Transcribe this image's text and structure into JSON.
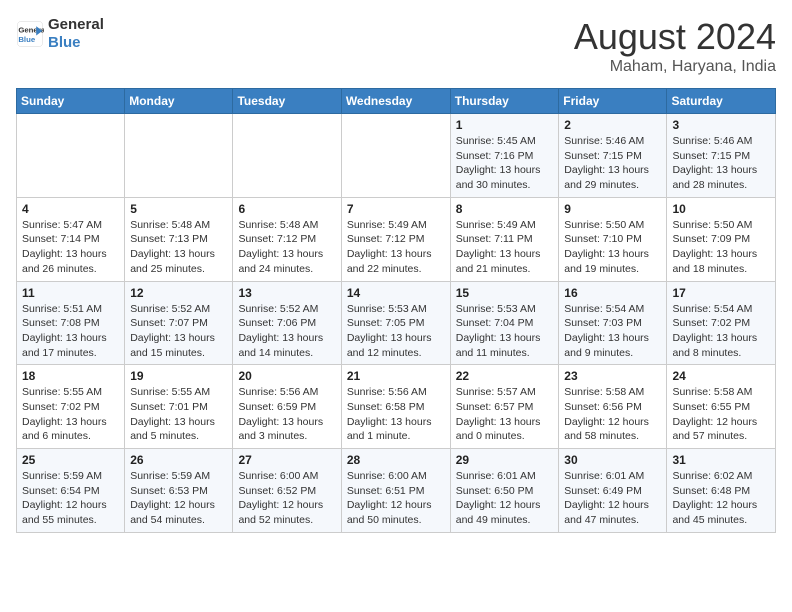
{
  "header": {
    "logo_line1": "General",
    "logo_line2": "Blue",
    "month_year": "August 2024",
    "location": "Maham, Haryana, India"
  },
  "weekdays": [
    "Sunday",
    "Monday",
    "Tuesday",
    "Wednesday",
    "Thursday",
    "Friday",
    "Saturday"
  ],
  "weeks": [
    [
      {
        "day": "",
        "info": ""
      },
      {
        "day": "",
        "info": ""
      },
      {
        "day": "",
        "info": ""
      },
      {
        "day": "",
        "info": ""
      },
      {
        "day": "1",
        "info": "Sunrise: 5:45 AM\nSunset: 7:16 PM\nDaylight: 13 hours\nand 30 minutes."
      },
      {
        "day": "2",
        "info": "Sunrise: 5:46 AM\nSunset: 7:15 PM\nDaylight: 13 hours\nand 29 minutes."
      },
      {
        "day": "3",
        "info": "Sunrise: 5:46 AM\nSunset: 7:15 PM\nDaylight: 13 hours\nand 28 minutes."
      }
    ],
    [
      {
        "day": "4",
        "info": "Sunrise: 5:47 AM\nSunset: 7:14 PM\nDaylight: 13 hours\nand 26 minutes."
      },
      {
        "day": "5",
        "info": "Sunrise: 5:48 AM\nSunset: 7:13 PM\nDaylight: 13 hours\nand 25 minutes."
      },
      {
        "day": "6",
        "info": "Sunrise: 5:48 AM\nSunset: 7:12 PM\nDaylight: 13 hours\nand 24 minutes."
      },
      {
        "day": "7",
        "info": "Sunrise: 5:49 AM\nSunset: 7:12 PM\nDaylight: 13 hours\nand 22 minutes."
      },
      {
        "day": "8",
        "info": "Sunrise: 5:49 AM\nSunset: 7:11 PM\nDaylight: 13 hours\nand 21 minutes."
      },
      {
        "day": "9",
        "info": "Sunrise: 5:50 AM\nSunset: 7:10 PM\nDaylight: 13 hours\nand 19 minutes."
      },
      {
        "day": "10",
        "info": "Sunrise: 5:50 AM\nSunset: 7:09 PM\nDaylight: 13 hours\nand 18 minutes."
      }
    ],
    [
      {
        "day": "11",
        "info": "Sunrise: 5:51 AM\nSunset: 7:08 PM\nDaylight: 13 hours\nand 17 minutes."
      },
      {
        "day": "12",
        "info": "Sunrise: 5:52 AM\nSunset: 7:07 PM\nDaylight: 13 hours\nand 15 minutes."
      },
      {
        "day": "13",
        "info": "Sunrise: 5:52 AM\nSunset: 7:06 PM\nDaylight: 13 hours\nand 14 minutes."
      },
      {
        "day": "14",
        "info": "Sunrise: 5:53 AM\nSunset: 7:05 PM\nDaylight: 13 hours\nand 12 minutes."
      },
      {
        "day": "15",
        "info": "Sunrise: 5:53 AM\nSunset: 7:04 PM\nDaylight: 13 hours\nand 11 minutes."
      },
      {
        "day": "16",
        "info": "Sunrise: 5:54 AM\nSunset: 7:03 PM\nDaylight: 13 hours\nand 9 minutes."
      },
      {
        "day": "17",
        "info": "Sunrise: 5:54 AM\nSunset: 7:02 PM\nDaylight: 13 hours\nand 8 minutes."
      }
    ],
    [
      {
        "day": "18",
        "info": "Sunrise: 5:55 AM\nSunset: 7:02 PM\nDaylight: 13 hours\nand 6 minutes."
      },
      {
        "day": "19",
        "info": "Sunrise: 5:55 AM\nSunset: 7:01 PM\nDaylight: 13 hours\nand 5 minutes."
      },
      {
        "day": "20",
        "info": "Sunrise: 5:56 AM\nSunset: 6:59 PM\nDaylight: 13 hours\nand 3 minutes."
      },
      {
        "day": "21",
        "info": "Sunrise: 5:56 AM\nSunset: 6:58 PM\nDaylight: 13 hours\nand 1 minute."
      },
      {
        "day": "22",
        "info": "Sunrise: 5:57 AM\nSunset: 6:57 PM\nDaylight: 13 hours\nand 0 minutes."
      },
      {
        "day": "23",
        "info": "Sunrise: 5:58 AM\nSunset: 6:56 PM\nDaylight: 12 hours\nand 58 minutes."
      },
      {
        "day": "24",
        "info": "Sunrise: 5:58 AM\nSunset: 6:55 PM\nDaylight: 12 hours\nand 57 minutes."
      }
    ],
    [
      {
        "day": "25",
        "info": "Sunrise: 5:59 AM\nSunset: 6:54 PM\nDaylight: 12 hours\nand 55 minutes."
      },
      {
        "day": "26",
        "info": "Sunrise: 5:59 AM\nSunset: 6:53 PM\nDaylight: 12 hours\nand 54 minutes."
      },
      {
        "day": "27",
        "info": "Sunrise: 6:00 AM\nSunset: 6:52 PM\nDaylight: 12 hours\nand 52 minutes."
      },
      {
        "day": "28",
        "info": "Sunrise: 6:00 AM\nSunset: 6:51 PM\nDaylight: 12 hours\nand 50 minutes."
      },
      {
        "day": "29",
        "info": "Sunrise: 6:01 AM\nSunset: 6:50 PM\nDaylight: 12 hours\nand 49 minutes."
      },
      {
        "day": "30",
        "info": "Sunrise: 6:01 AM\nSunset: 6:49 PM\nDaylight: 12 hours\nand 47 minutes."
      },
      {
        "day": "31",
        "info": "Sunrise: 6:02 AM\nSunset: 6:48 PM\nDaylight: 12 hours\nand 45 minutes."
      }
    ]
  ]
}
